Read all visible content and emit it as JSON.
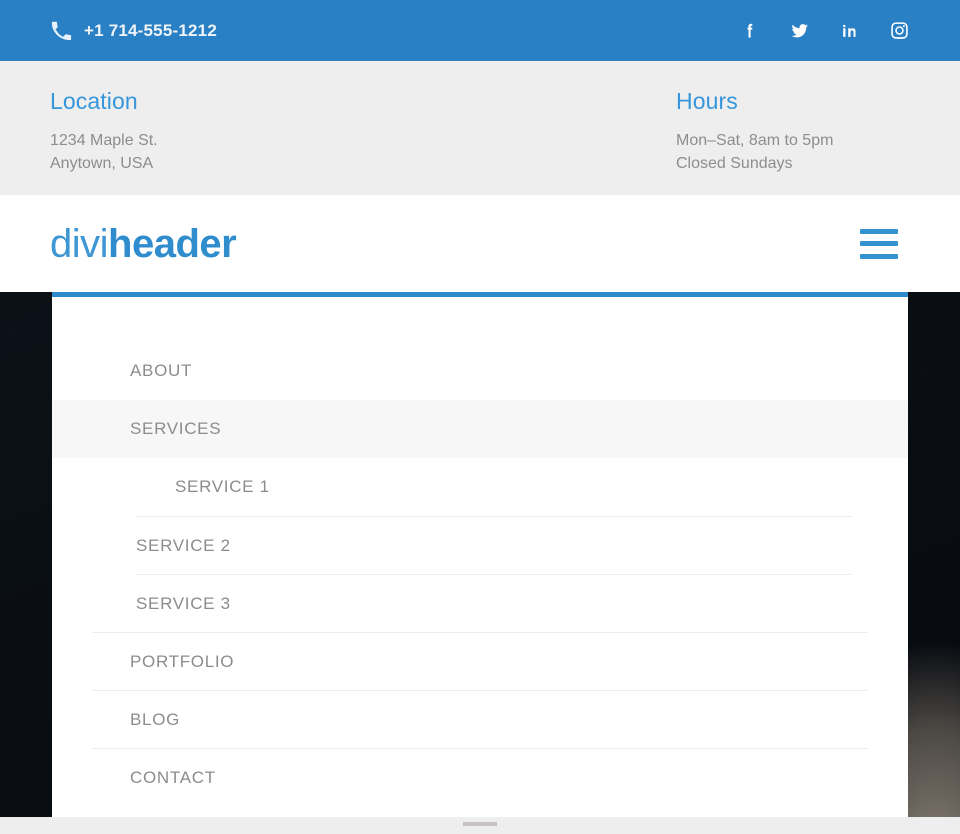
{
  "topbar": {
    "phone_icon": "phone-icon",
    "phone_number": "+1 714-555-1212",
    "social": [
      {
        "name": "facebook-icon",
        "label": "Facebook"
      },
      {
        "name": "twitter-icon",
        "label": "Twitter"
      },
      {
        "name": "linkedin-icon",
        "label": "LinkedIn"
      },
      {
        "name": "instagram-icon",
        "label": "Instagram"
      }
    ],
    "bg_color": "#2980c4"
  },
  "info": {
    "location": {
      "title": "Location",
      "line1": "1234 Maple St.",
      "line2": "Anytown, USA"
    },
    "hours": {
      "title": "Hours",
      "line1": "Mon–Sat, 8am to 5pm",
      "line2": "Closed Sundays"
    },
    "title_color": "#3596db",
    "bg_color": "#eeeeee"
  },
  "header": {
    "logo_light": "divi",
    "logo_bold": "header",
    "logo_color": "#3392d2",
    "menu_toggle": "menu-toggle"
  },
  "dropdown": {
    "accent_color": "#2e8bcb",
    "items": [
      {
        "label": "ABOUT",
        "level": "top",
        "active": false,
        "divider": false
      },
      {
        "label": "SERVICES",
        "level": "top",
        "active": true,
        "divider": false
      },
      {
        "label": "SERVICE 1",
        "level": "sub",
        "active": false,
        "divider": false
      },
      {
        "label": "SERVICE 2",
        "level": "sub",
        "active": false,
        "divider": true
      },
      {
        "label": "SERVICE 3",
        "level": "sub",
        "active": false,
        "divider": true
      },
      {
        "label": "PORTFOLIO",
        "level": "top",
        "active": false,
        "divider": true
      },
      {
        "label": "BLOG",
        "level": "top",
        "active": false,
        "divider": true
      },
      {
        "label": "CONTACT",
        "level": "top",
        "active": false,
        "divider": true
      }
    ]
  }
}
